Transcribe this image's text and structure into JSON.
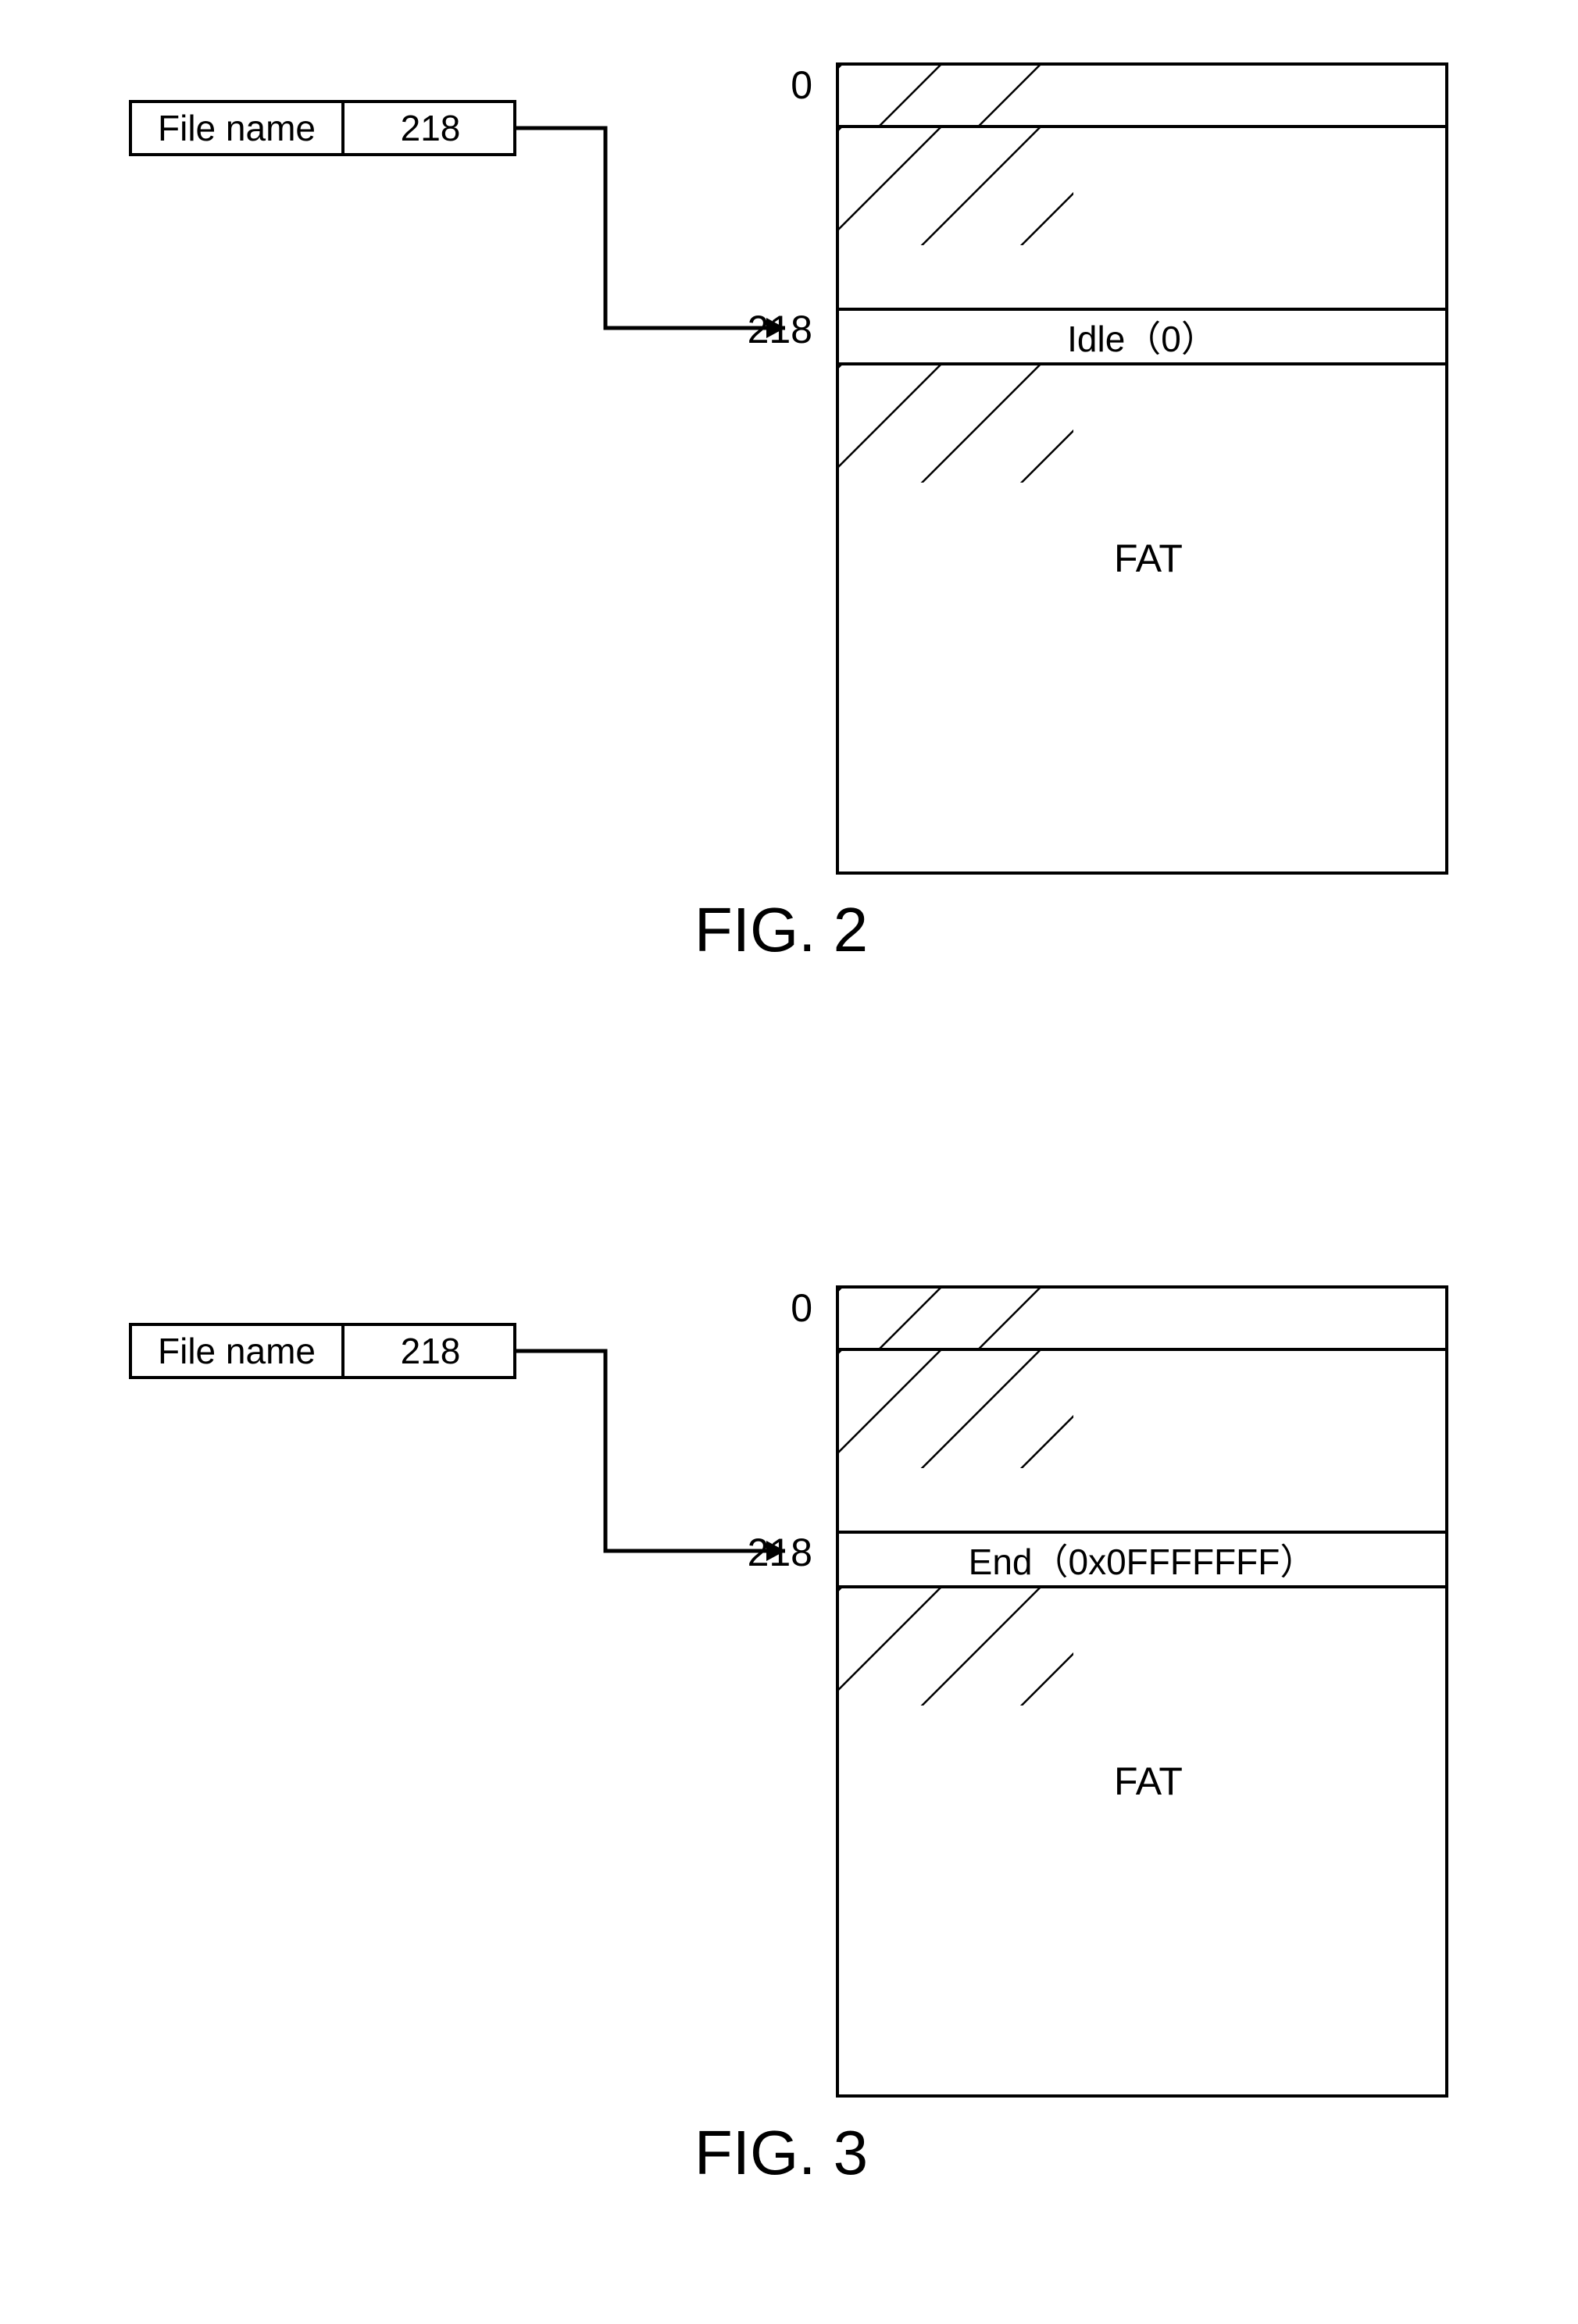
{
  "fig2": {
    "file_entry": {
      "label": "File name",
      "cluster": "218"
    },
    "fat": {
      "top_index": "0",
      "target_index": "218",
      "target_value": "Idle（0）",
      "area_label": "FAT"
    },
    "caption": "FIG. 2"
  },
  "fig3": {
    "file_entry": {
      "label": "File name",
      "cluster": "218"
    },
    "fat": {
      "top_index": "0",
      "target_index": "218",
      "target_value": "End（0x0FFFFFFF）",
      "area_label": "FAT"
    },
    "caption": "FIG. 3"
  }
}
